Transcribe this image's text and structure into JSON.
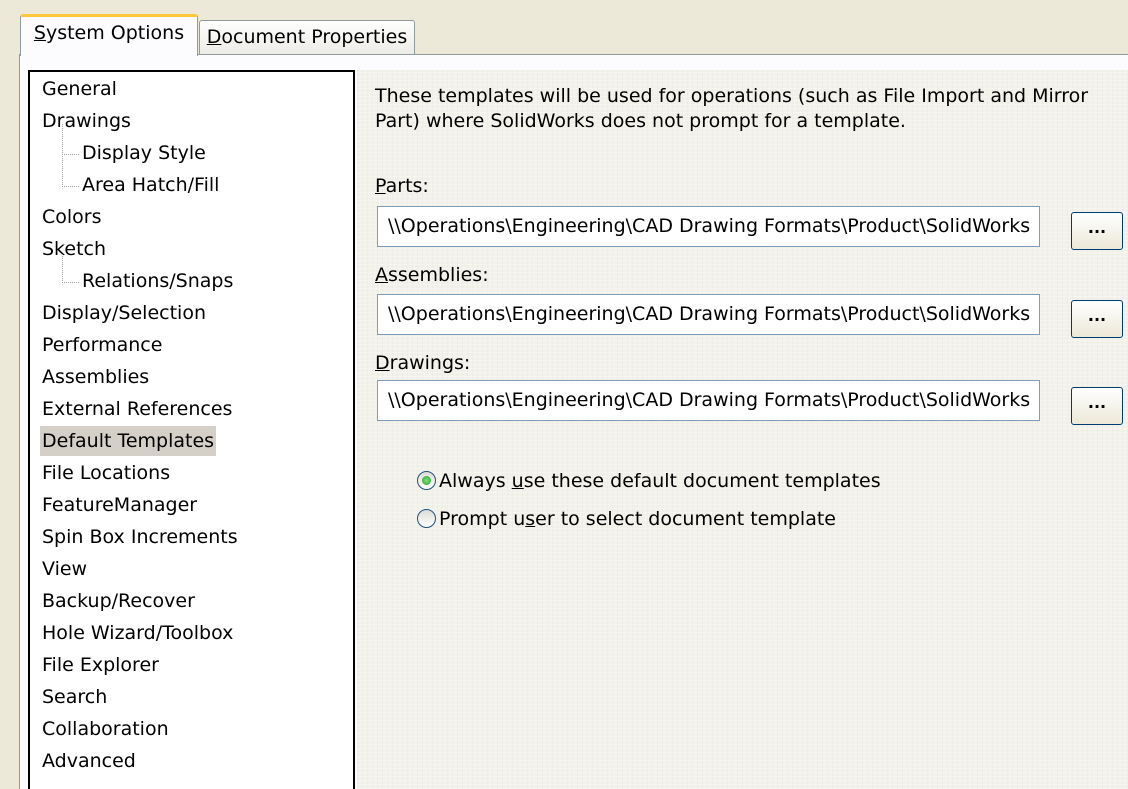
{
  "tabs": [
    {
      "label": "System Options",
      "active": true,
      "access_key": "S"
    },
    {
      "label": "Document Properties",
      "active": false,
      "access_key": "D"
    }
  ],
  "tree": {
    "items": [
      {
        "label": "General",
        "child": false,
        "selected": false
      },
      {
        "label": "Drawings",
        "child": false,
        "selected": false
      },
      {
        "label": "Display Style",
        "child": true,
        "selected": false
      },
      {
        "label": "Area Hatch/Fill",
        "child": true,
        "selected": false
      },
      {
        "label": "Colors",
        "child": false,
        "selected": false
      },
      {
        "label": "Sketch",
        "child": false,
        "selected": false
      },
      {
        "label": "Relations/Snaps",
        "child": true,
        "selected": false
      },
      {
        "label": "Display/Selection",
        "child": false,
        "selected": false
      },
      {
        "label": "Performance",
        "child": false,
        "selected": false
      },
      {
        "label": "Assemblies",
        "child": false,
        "selected": false
      },
      {
        "label": "External References",
        "child": false,
        "selected": false
      },
      {
        "label": "Default Templates",
        "child": false,
        "selected": true
      },
      {
        "label": "File Locations",
        "child": false,
        "selected": false
      },
      {
        "label": "FeatureManager",
        "child": false,
        "selected": false
      },
      {
        "label": "Spin Box Increments",
        "child": false,
        "selected": false
      },
      {
        "label": "View",
        "child": false,
        "selected": false
      },
      {
        "label": "Backup/Recover",
        "child": false,
        "selected": false
      },
      {
        "label": "Hole Wizard/Toolbox",
        "child": false,
        "selected": false
      },
      {
        "label": "File Explorer",
        "child": false,
        "selected": false
      },
      {
        "label": "Search",
        "child": false,
        "selected": false
      },
      {
        "label": "Collaboration",
        "child": false,
        "selected": false
      },
      {
        "label": "Advanced",
        "child": false,
        "selected": false
      }
    ]
  },
  "content": {
    "description": "These templates will be used for operations (such as File Import and Mirror Part) where SolidWorks does not prompt for a template.",
    "parts": {
      "label": "Parts:",
      "access_key": "P",
      "value": "\\\\Operations\\Engineering\\CAD Drawing Formats\\Product\\SolidWorks",
      "browse_label": "..."
    },
    "assemblies": {
      "label": "Assemblies:",
      "access_key": "A",
      "value": "\\\\Operations\\Engineering\\CAD Drawing Formats\\Product\\SolidWorks",
      "browse_label": "..."
    },
    "drawings": {
      "label": "Drawings:",
      "access_key": "D",
      "value": "\\\\Operations\\Engineering\\CAD Drawing Formats\\Product\\SolidWorks",
      "browse_label": "..."
    },
    "options": [
      {
        "label": "Always use these default document templates",
        "access_key": "u",
        "checked": true
      },
      {
        "label": "Prompt user to select document template",
        "access_key": "s",
        "checked": false
      }
    ]
  }
}
